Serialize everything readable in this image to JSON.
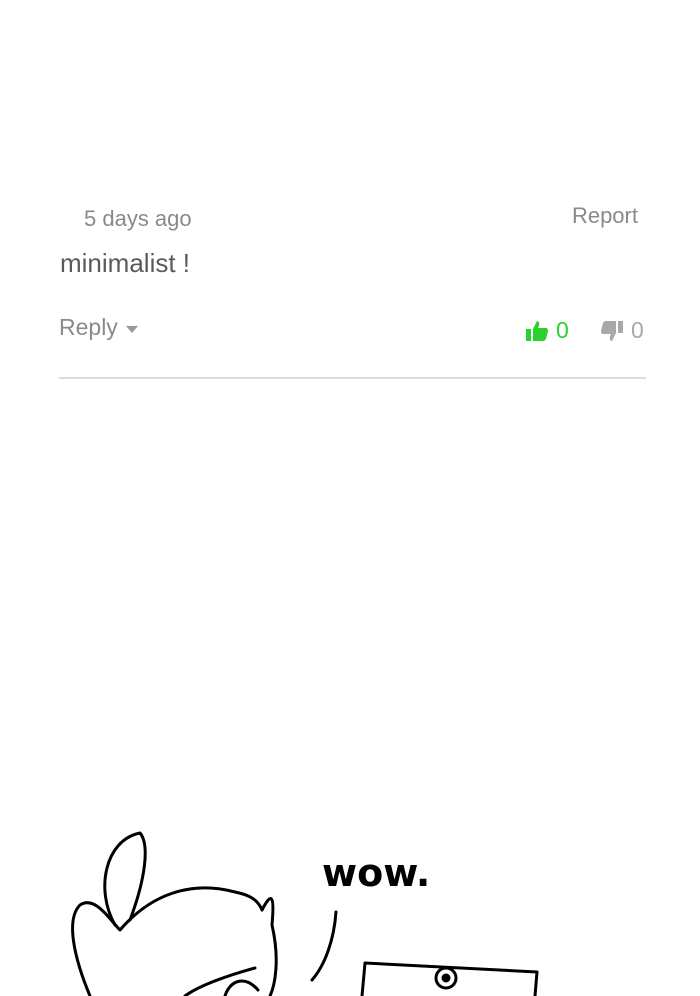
{
  "comment": {
    "timestamp": "5 days ago",
    "report_label": "Report",
    "body": "minimalist !",
    "reply_label": "Reply",
    "likes": "0",
    "dislikes": "0",
    "colors": {
      "like": "#2bd22b",
      "dislike": "#a8a8a8",
      "meta": "#8a8a8a"
    }
  },
  "comic": {
    "speech_text": "wow."
  },
  "icons": {
    "like": "thumbs-up-icon",
    "dislike": "thumbs-down-icon",
    "reply_caret": "caret-down-icon"
  }
}
